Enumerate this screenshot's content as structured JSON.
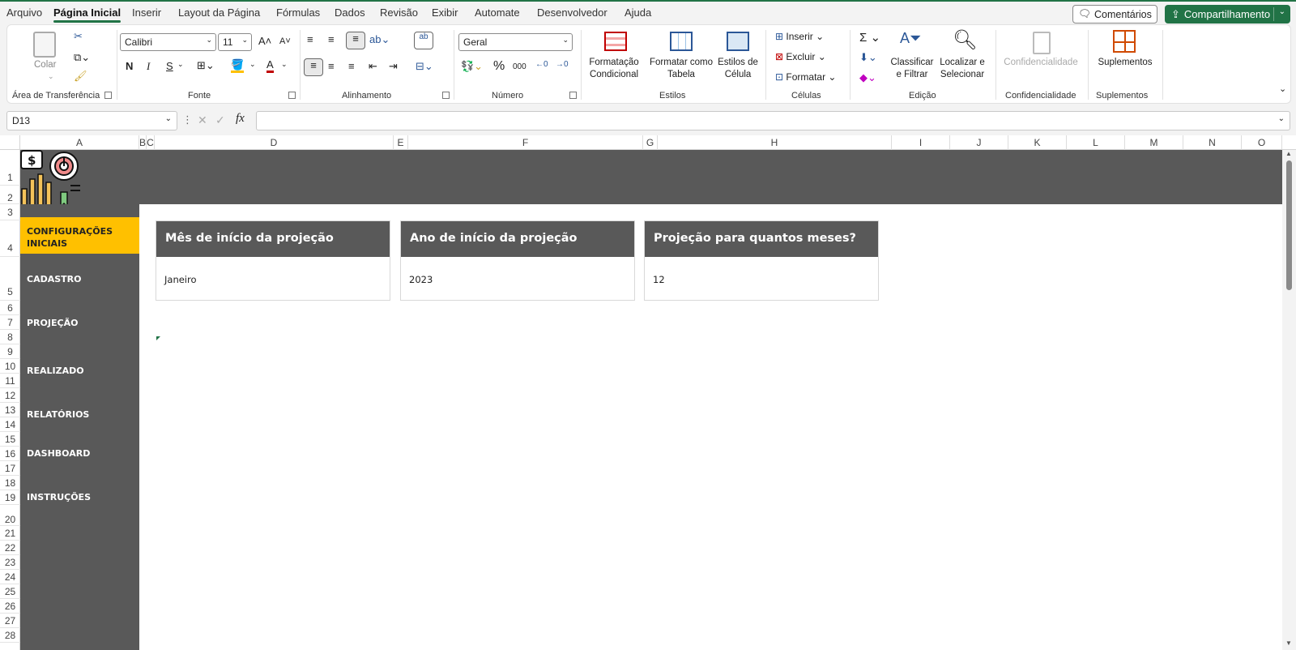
{
  "menu": {
    "items": [
      "Arquivo",
      "Página Inicial",
      "Inserir",
      "Layout da Página",
      "Fórmulas",
      "Dados",
      "Revisão",
      "Exibir",
      "Automate",
      "Desenvolvedor",
      "Ajuda"
    ],
    "comments_label": "Comentários",
    "share_label": "Compartilhamento"
  },
  "ribbon": {
    "paste_label": "Colar",
    "font_name": "Calibri",
    "font_size": "11",
    "bold": "N",
    "italic": "I",
    "underline": "S",
    "number_format": "Geral",
    "cond_format": "Formatação\nCondicional",
    "format_table": "Formatar como\nTabela",
    "cell_styles": "Estilos de\nCélula",
    "insert": "Inserir",
    "delete": "Excluir",
    "format": "Formatar",
    "sort_filter": "Classificar\ne Filtrar",
    "find_select": "Localizar e\nSelecionar",
    "sensitivity": "Confidencialidade",
    "addins": "Suplementos",
    "groups": [
      "Área de Transferência",
      "Fonte",
      "Alinhamento",
      "Número",
      "Estilos",
      "Células",
      "Edição",
      "Confidencialidade",
      "Suplementos"
    ]
  },
  "namebox": "D13",
  "columns": [
    "A",
    "B",
    "C",
    "D",
    "E",
    "F",
    "G",
    "H",
    "I",
    "J",
    "K",
    "L",
    "M",
    "N",
    "O"
  ],
  "rows": [
    "1",
    "2",
    "3",
    "4",
    "5",
    "6",
    "7",
    "8",
    "9",
    "10",
    "11",
    "12",
    "13",
    "14",
    "15",
    "16",
    "17",
    "18",
    "19",
    "20",
    "21",
    "22",
    "23",
    "24",
    "25",
    "26",
    "27",
    "28"
  ],
  "nav": [
    "CONFIGURAÇÕES INICIAIS",
    "CADASTRO",
    "PROJEÇÃO",
    "REALIZADO",
    "RELATÓRIOS",
    "DASHBOARD",
    "INSTRUÇÕES"
  ],
  "cards": [
    {
      "title": "Mês de início da projeção",
      "value": "Janeiro"
    },
    {
      "title": "Ano de início da projeção",
      "value": "2023"
    },
    {
      "title": "Projeção para quantos meses?",
      "value": "12"
    }
  ],
  "colors": {
    "accent": "#217346",
    "sidebar": "#595959",
    "active_nav": "#ffc000"
  }
}
